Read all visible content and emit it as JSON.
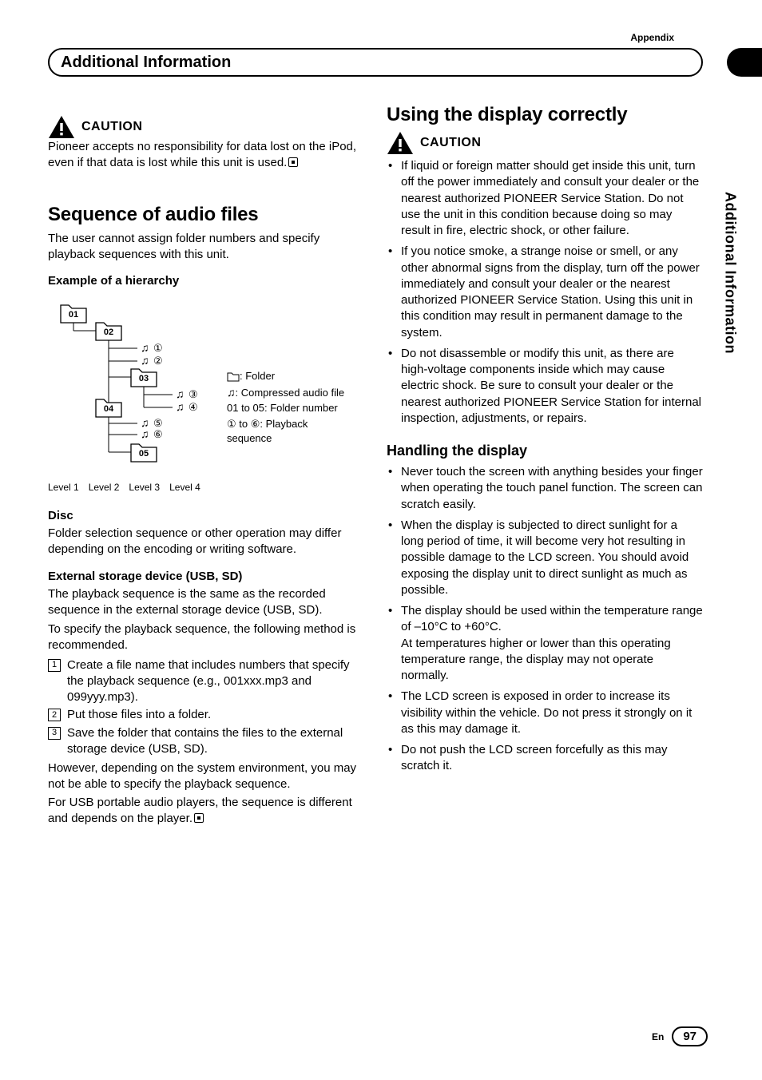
{
  "appendix_label": "Appendix",
  "header_title": "Additional Information",
  "side_tab_text": "Additional Information",
  "left": {
    "caution_label": "CAUTION",
    "caution_body": "Pioneer accepts no responsibility for data lost on the iPod, even if that data is lost while this unit is used.",
    "seq_heading": "Sequence of audio files",
    "seq_intro": "The user cannot assign folder numbers and specify playback sequences with this unit.",
    "example_heading": "Example of a hierarchy",
    "folders": {
      "f1": "01",
      "f2": "02",
      "f3": "03",
      "f4": "04",
      "f5": "05"
    },
    "circled": {
      "c1": "①",
      "c2": "②",
      "c3": "③",
      "c4": "④",
      "c5": "⑤",
      "c6": "⑥"
    },
    "levels": {
      "l1": "Level 1",
      "l2": "Level 2",
      "l3": "Level 3",
      "l4": "Level 4"
    },
    "legend": {
      "folder": ": Folder",
      "audio": ": Compressed audio file",
      "range": "01 to 05: Folder number",
      "seq": "① to ⑥: Playback sequence"
    },
    "disc_heading": "Disc",
    "disc_body": "Folder selection sequence or other operation may differ depending on the encoding or writing software.",
    "ext_heading": "External storage device (USB, SD)",
    "ext_p1": "The playback sequence is the same as the recorded sequence in the external storage device (USB, SD).",
    "ext_p2": "To specify the playback sequence, the following method is recommended.",
    "steps": {
      "s1n": "1",
      "s1": "Create a file name that includes numbers that specify the playback sequence (e.g., 001xxx.mp3 and 099yyy.mp3).",
      "s2n": "2",
      "s2": "Put those files into a folder.",
      "s3n": "3",
      "s3": "Save the folder that contains the files to the external storage device (USB, SD)."
    },
    "ext_p3": "However, depending on the system environment, you may not be able to specify the playback sequence.",
    "ext_p4": "For USB portable audio players, the sequence is different and depends on the player."
  },
  "right": {
    "use_heading": "Using the display correctly",
    "caution_label": "CAUTION",
    "caution_items": {
      "c1": "If liquid or foreign matter should get inside this unit, turn off the power immediately and consult your dealer or the nearest authorized PIONEER Service Station. Do not use the unit in this condition because doing so may result in fire, electric shock, or other failure.",
      "c2": "If you notice smoke, a strange noise or smell, or any other abnormal signs from the display, turn off the power immediately and consult your dealer or the nearest authorized PIONEER Service Station. Using this unit in this condition may result in permanent damage to the system.",
      "c3": "Do not disassemble or modify this unit, as there are high-voltage components inside which may cause electric shock. Be sure to consult your dealer or the nearest authorized PIONEER Service Station for internal inspection, adjustments, or repairs."
    },
    "handling_heading": "Handling the display",
    "handling_items": {
      "h1": "Never touch the screen with anything besides your finger when operating the touch panel function. The screen can scratch easily.",
      "h2": "When the display is subjected to direct sunlight for a long period of time, it will become very hot resulting in possible damage to the LCD screen. You should avoid exposing the display unit to direct sunlight as much as possible.",
      "h3a": "The display should be used within the temperature range of  –10°C to  +60°C.",
      "h3b": "At temperatures higher or lower than this operating temperature range, the display may not operate normally.",
      "h4": "The LCD screen is exposed in order to increase its visibility within the vehicle. Do not press it strongly on it as this may damage it.",
      "h5": "Do not push the LCD screen forcefully as this may scratch it."
    }
  },
  "footer": {
    "lang": "En",
    "page": "97"
  }
}
